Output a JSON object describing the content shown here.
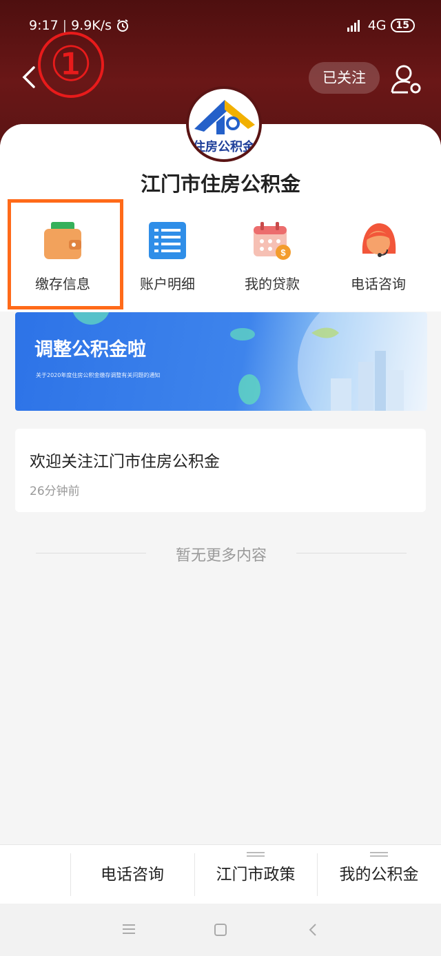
{
  "status_bar": {
    "time": "9:17",
    "speed": "9.9K/s",
    "network": "4G",
    "battery": "15"
  },
  "header": {
    "step_marker": "①",
    "follow_button": "已关注",
    "logo_text": "住房公积金"
  },
  "account": {
    "name": "江门市住房公积金"
  },
  "menu": [
    {
      "label": "缴存信息",
      "icon": "wallet-icon"
    },
    {
      "label": "账户明细",
      "icon": "list-icon"
    },
    {
      "label": "我的贷款",
      "icon": "loan-calendar-icon"
    },
    {
      "label": "电话咨询",
      "icon": "customer-service-icon"
    }
  ],
  "banner": {
    "title": "调整公积金啦",
    "subtitle": "关于2020年度住房公积金缴存调整有关问题的通知"
  },
  "messages": [
    {
      "title": "欢迎关注江门市住房公积金",
      "time": "26分钟前"
    }
  ],
  "no_more_text": "暂无更多内容",
  "bottom_nav": [
    {
      "label": "电话咨询",
      "has_submenu": false
    },
    {
      "label": "江门市政策",
      "has_submenu": true
    },
    {
      "label": "我的公积金",
      "has_submenu": true
    }
  ],
  "colors": {
    "header_bg": "#5a1414",
    "highlight": "#ff6a19",
    "step_marker": "#e81b1b",
    "banner": "#2d73e7"
  }
}
